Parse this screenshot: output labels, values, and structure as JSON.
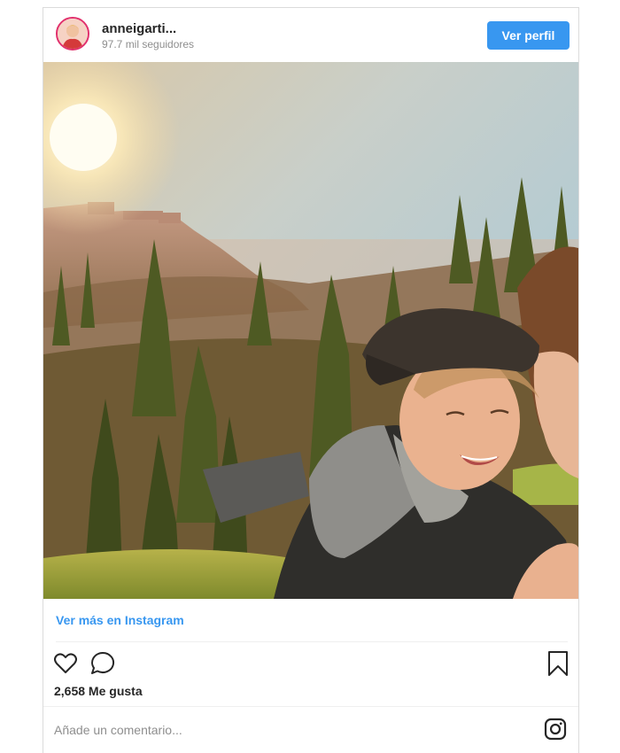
{
  "post": {
    "username": "anneigarti...",
    "followers": "97.7 mil seguidores",
    "profile_button": "Ver perfil",
    "view_more_link": "Ver más en Instagram",
    "likes": "2,658 Me gusta",
    "comment_placeholder": "Añade un comentario..."
  },
  "icons": {
    "like": "heart-icon",
    "comment": "comment-bubble-icon",
    "save": "bookmark-icon",
    "instagram": "instagram-logo-icon"
  },
  "colors": {
    "accent": "#3897f0",
    "text": "#262626",
    "muted": "#8e8e8e",
    "border": "#dbdbdb"
  }
}
